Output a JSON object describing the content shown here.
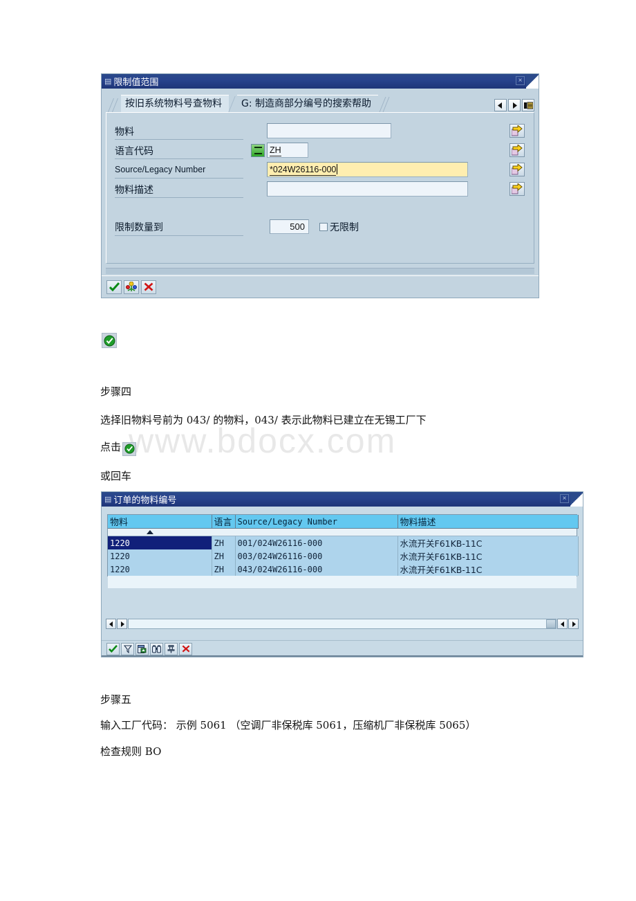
{
  "watermark": "www.bdocx.com",
  "dialog_limit": {
    "title": "限制值范围",
    "close_label": "×",
    "tabs": [
      {
        "label": "按旧系统物料号查物料",
        "active": true
      },
      {
        "label": "G: 制造商部分编号的搜索帮助",
        "active": false
      }
    ],
    "nav": {
      "prev": "prev-tab",
      "next": "next-tab",
      "list": "tab-list"
    },
    "fields": [
      {
        "label": "物料",
        "value": "",
        "operator": "",
        "script": "cjk"
      },
      {
        "label": "语言代码",
        "value": "ZH",
        "operator": "=",
        "script": "cjk"
      },
      {
        "label": "Source/Legacy Number",
        "value": "*024W26116-000",
        "operator": "",
        "script": "latin"
      },
      {
        "label": "物料描述",
        "value": "",
        "operator": "",
        "script": "cjk"
      }
    ],
    "limit": {
      "label": "限制数量到",
      "value": "500",
      "checkbox_label": "无限制",
      "checkbox_checked": false
    },
    "toolbar": [
      {
        "name": "execute-check",
        "title": "执行"
      },
      {
        "name": "multiple-selection",
        "title": "多重选择"
      },
      {
        "name": "cancel",
        "title": "取消"
      }
    ]
  },
  "standalone_icon": {
    "name": "green-check-enter"
  },
  "body": {
    "step4_title": "步骤四",
    "step4_line1": "选择旧物料号前为 043/ 的物料，043/ 表示此物料已建立在无锡工厂下",
    "step4_click_prefix": "点击",
    "step4_or_enter": "或回车",
    "step5_title": "步骤五",
    "step5_line1": "输入工厂代码： 示例 5061 （空调厂非保税库 5061，压缩机厂非保税库 5065）",
    "step5_line2": "检查规则 BO"
  },
  "dialog_order": {
    "title": "订单的物料编号",
    "close_label": "×",
    "columns": [
      "物料",
      "语言",
      "Source/Legacy Number",
      "物料描述"
    ],
    "rows": [
      {
        "material": "1220",
        "language": "ZH",
        "legacy": "001/024W26116-000",
        "description": "水流开关F61KB-11C",
        "selected": true
      },
      {
        "material": "1220",
        "language": "ZH",
        "legacy": "003/024W26116-000",
        "description": "水流开关F61KB-11C",
        "selected": false
      },
      {
        "material": "1220",
        "language": "ZH",
        "legacy": "043/024W26116-000",
        "description": "水流开关F61KB-11C",
        "selected": false
      }
    ],
    "toolbar": [
      {
        "name": "copy-check"
      },
      {
        "name": "filter"
      },
      {
        "name": "sort-table"
      },
      {
        "name": "find"
      },
      {
        "name": "pin"
      },
      {
        "name": "cancel"
      }
    ]
  },
  "colors": {
    "title_bar": "#27428c",
    "dialog_bg": "#c3d4e0",
    "active_field": "#ffeeb0",
    "grid_header": "#63c8f0",
    "row_selected": "#11207a",
    "row_bg": "#aed4ec"
  }
}
